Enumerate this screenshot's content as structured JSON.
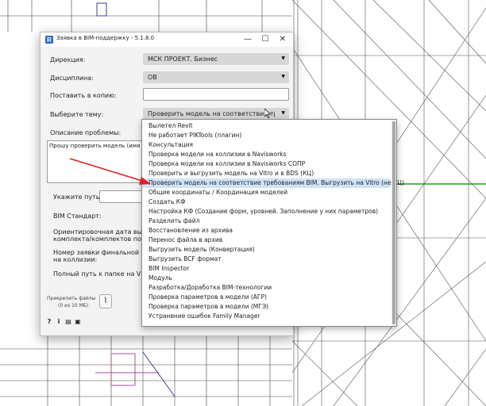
{
  "window": {
    "title": "Заявка в BIM-поддержку - 5.1.8.0",
    "minimize_glyph": "—",
    "maximize_glyph": "☐",
    "close_glyph": "✕",
    "app_icon": "revit-r-icon"
  },
  "form": {
    "direction_label": "Дирекция:",
    "direction_value": "МСК ПРОЕКТ. Бизнес",
    "discipline_label": "Дисциплина:",
    "discipline_value": "ОВ",
    "cc_label": "Поставить в копию:",
    "topic_label": "Выберите тему:",
    "topic_value": "Проверить модель на соответствие требов",
    "problem_label": "Описание проблемы:",
    "problem_text": "Прошу проверить модель (имя модели",
    "path_label": "Укажите путь:",
    "bim_standard_label": "BIM Стандарт:",
    "date_label_line1": "Ориентировочная дата выпуск",
    "date_label_line2": "комплекта/комплектов по мод",
    "final_number_line1": "Номер заявки финальной пров",
    "final_number_line2": "на коллизии:",
    "vitro_path_label": "Полный путь к папке на Vitro:",
    "attach_label": "Прикрепить файлы",
    "attach_limit": "(0 из 10 МБ)",
    "attach_icon": "paperclip-icon"
  },
  "bottom_icons": [
    {
      "glyph": "?",
      "name": "help-icon"
    },
    {
      "glyph": "i",
      "name": "info-icon"
    },
    {
      "glyph": "▤",
      "name": "notes-icon"
    },
    {
      "glyph": "▣",
      "name": "screenshot-icon"
    }
  ],
  "dropdown": {
    "items": [
      "Вылетел Revit",
      "Не работает PIKTools (плагин)",
      "Консультация",
      "Проверка модели на коллизии в Navisworks",
      "Проверка модели на коллизии в Navisworks СОПР",
      "Проверить и выгрузить модель на Vitro и в BDS (КЦ)",
      "Проверить модель на соответствие требованиям BIM. Выгрузить на Vitro (не КЦ)",
      "Общие координаты / Координация моделей",
      "Создать КФ",
      "Настройка КФ (Создание форм, уровней. Заполнение у них параметров)",
      "Разделить файл",
      "Восстановление из архива",
      "Перенос файла в архив",
      "Выгрузить модель (Конвертация)",
      "Выгрузить BCF формат",
      "BIM Inspector",
      "Модуль",
      "Разработка/Доработка BIM-технологии",
      "Проверка параметров в модели (АГР)",
      "Проверка параметров в модели (МГЭ)",
      "Устранение ошибок Family Manager"
    ],
    "selected_index": 6
  },
  "colors": {
    "accent_arrow": "#e02020",
    "selection": "#cfe3f7",
    "green_line": "#18a018"
  }
}
